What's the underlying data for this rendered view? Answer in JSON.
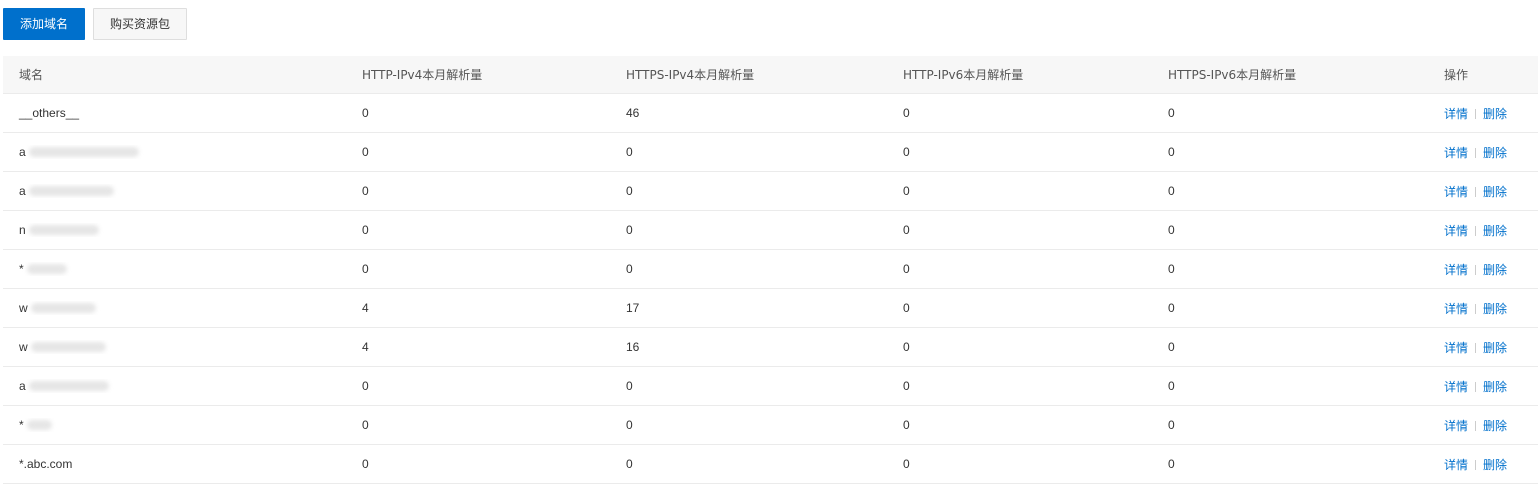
{
  "toolbar": {
    "add_domain_label": "添加域名",
    "buy_package_label": "购买资源包"
  },
  "table": {
    "columns": [
      "域名",
      "HTTP-IPv4本月解析量",
      "HTTPS-IPv4本月解析量",
      "HTTP-IPv6本月解析量",
      "HTTPS-IPv6本月解析量",
      "操作"
    ],
    "action_labels": {
      "detail": "详情",
      "delete": "删除"
    },
    "rows": [
      {
        "domain": "__others__",
        "blurred": false,
        "http_ipv4": "0",
        "https_ipv4": "46",
        "http_ipv6": "0",
        "https_ipv6": "0"
      },
      {
        "domain": "a",
        "blurred": true,
        "http_ipv4": "0",
        "https_ipv4": "0",
        "http_ipv6": "0",
        "https_ipv6": "0"
      },
      {
        "domain": "a",
        "blurred": true,
        "http_ipv4": "0",
        "https_ipv4": "0",
        "http_ipv6": "0",
        "https_ipv6": "0"
      },
      {
        "domain": "n",
        "blurred": true,
        "http_ipv4": "0",
        "https_ipv4": "0",
        "http_ipv6": "0",
        "https_ipv6": "0"
      },
      {
        "domain": "*",
        "blurred": true,
        "http_ipv4": "0",
        "https_ipv4": "0",
        "http_ipv6": "0",
        "https_ipv6": "0"
      },
      {
        "domain": "w",
        "blurred": true,
        "http_ipv4": "4",
        "https_ipv4": "17",
        "http_ipv6": "0",
        "https_ipv6": "0"
      },
      {
        "domain": "w",
        "blurred": true,
        "http_ipv4": "4",
        "https_ipv4": "16",
        "http_ipv6": "0",
        "https_ipv6": "0"
      },
      {
        "domain": "a",
        "blurred": true,
        "http_ipv4": "0",
        "https_ipv4": "0",
        "http_ipv6": "0",
        "https_ipv6": "0"
      },
      {
        "domain": "*",
        "blurred": true,
        "http_ipv4": "0",
        "https_ipv4": "0",
        "http_ipv6": "0",
        "https_ipv6": "0"
      },
      {
        "domain": "*.abc.com",
        "blurred": false,
        "http_ipv4": "0",
        "https_ipv4": "0",
        "http_ipv6": "0",
        "https_ipv6": "0"
      }
    ]
  },
  "colors": {
    "primary": "#0070cc",
    "header_bg": "#f7f7f7",
    "row_border": "#ebebeb",
    "text": "#333333"
  }
}
